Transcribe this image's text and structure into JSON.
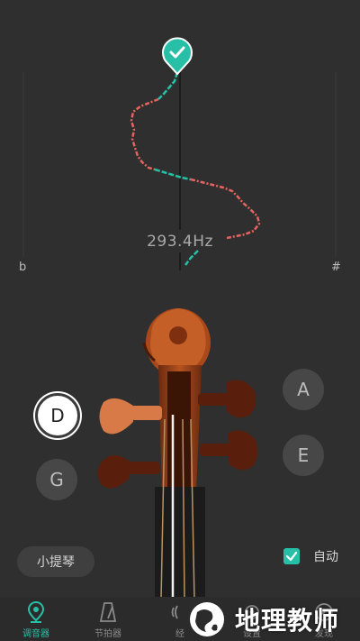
{
  "tuner": {
    "frequency": "293.4Hz",
    "flat_symbol": "b",
    "sharp_symbol": "#",
    "in_tune": true,
    "accent_color": "#27c0a7",
    "off_color": "#e5645f"
  },
  "strings": {
    "left": [
      {
        "note": "D",
        "active": true
      },
      {
        "note": "G",
        "active": false
      }
    ],
    "right": [
      {
        "note": "A",
        "active": false
      },
      {
        "note": "E",
        "active": false
      }
    ]
  },
  "instrument": {
    "label": "小提琴"
  },
  "auto": {
    "label": "自动",
    "checked": true
  },
  "tabs": [
    {
      "label": "调音器",
      "icon": "location-pin-icon",
      "active": true
    },
    {
      "label": "节拍器",
      "icon": "metronome-icon",
      "active": false
    },
    {
      "label": "经",
      "icon": "sound-icon",
      "active": false
    },
    {
      "label": "设置",
      "icon": "gear-icon",
      "active": false
    },
    {
      "label": "发现",
      "icon": "compass-icon",
      "active": false
    }
  ],
  "watermark": {
    "text": "地理教师"
  }
}
